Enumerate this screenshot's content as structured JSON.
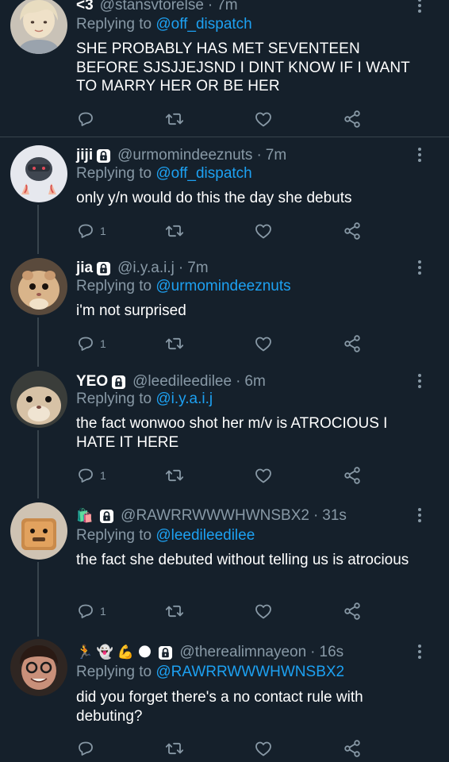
{
  "tweets": [
    {
      "name": "<3",
      "handle": "@stansvtorelse",
      "time": "7m",
      "replying_prefix": "Replying to ",
      "replying_to": "@off_dispatch",
      "text": "SHE PROBABLY HAS MET SEVENTEEN BEFORE SJSJJEJSND I DINT KNOW IF I WANT TO MARRY HER OR BE HER",
      "reply_count": "",
      "locked": false
    },
    {
      "name": "jiji",
      "handle": "@urmomindeeznuts",
      "time": "7m",
      "replying_prefix": "Replying to ",
      "replying_to": "@off_dispatch",
      "text": "only y/n would do this the day she debuts",
      "reply_count": "1",
      "locked": true
    },
    {
      "name": "jia",
      "handle": "@i.y.a.i.j",
      "time": "7m",
      "replying_prefix": "Replying to ",
      "replying_to": "@urmomindeeznuts",
      "text": "i'm not surprised",
      "reply_count": "1",
      "locked": true
    },
    {
      "name": "YEO",
      "handle": "@leedileedilee",
      "time": "6m",
      "replying_prefix": "Replying to ",
      "replying_to": "@i.y.a.i.j",
      "text": "the fact wonwoo shot her m/v is ATROCIOUS I HATE IT HERE",
      "reply_count": "1",
      "locked": true
    },
    {
      "name_emoji": "🛍️",
      "handle": "@RAWRRWWWHWNSBX2",
      "time": "31s",
      "replying_prefix": "Replying to ",
      "replying_to": "@leedileedilee",
      "text": "the fact she debuted without telling us is atrocious",
      "reply_count": "1",
      "locked": true
    },
    {
      "name_emoji": "🏃 👻 💪 🌑",
      "handle": "@therealimnayeon",
      "time": "16s",
      "replying_prefix": "Replying to ",
      "replying_to": "@RAWRRWWWHWNSBX2",
      "text": "did you forget there's a no contact rule with debuting?",
      "reply_count": "",
      "locked": true
    }
  ],
  "separator": "·",
  "icons": {
    "reply": "reply-bubble-icon",
    "retweet": "retweet-icon",
    "like": "heart-icon",
    "share": "share-icon",
    "more": "more-vertical-icon",
    "lock": "lock-icon"
  },
  "colors": {
    "background": "#15202b",
    "text": "#ffffff",
    "muted": "#8899a6",
    "link": "#1da1f2",
    "divider": "#38444d"
  }
}
